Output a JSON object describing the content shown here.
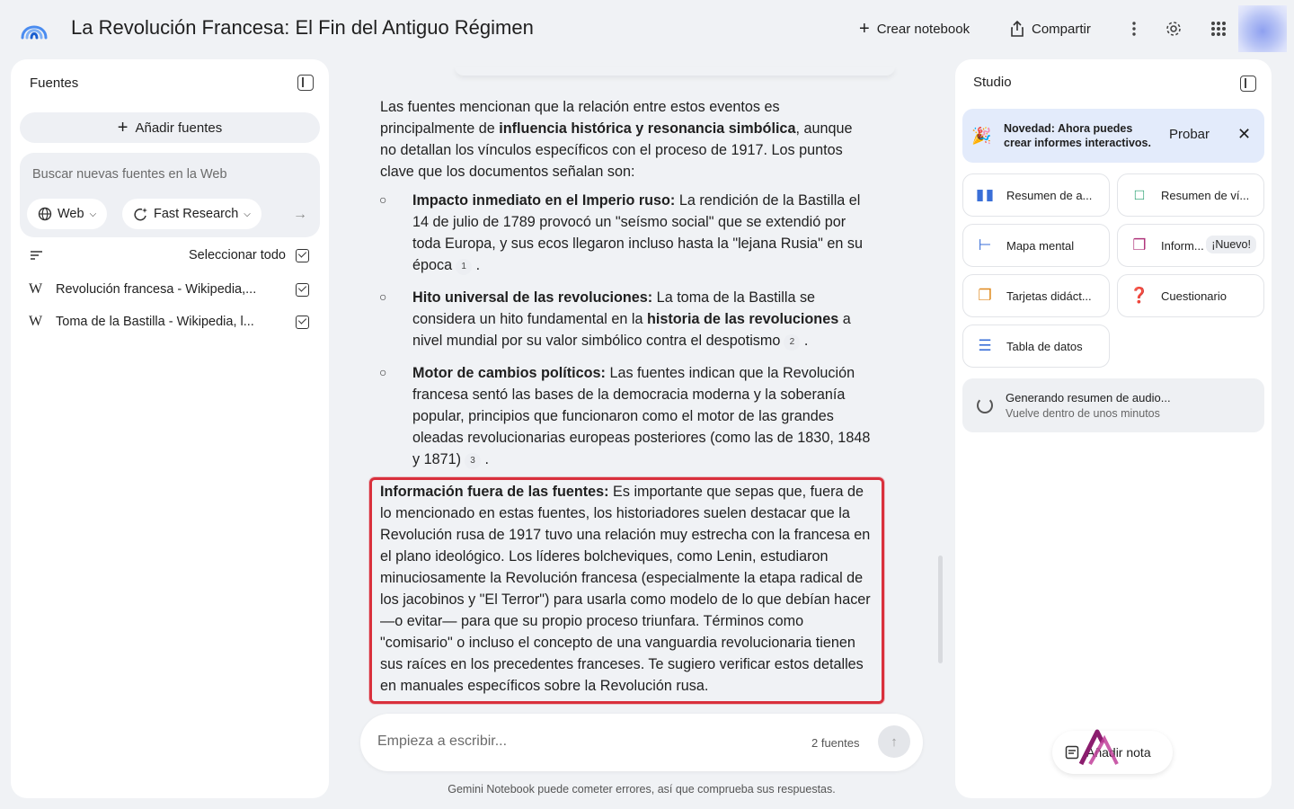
{
  "header": {
    "title": "La Revolución Francesa: El Fin del Antiguo Régimen",
    "create_label": "Crear notebook",
    "share_label": "Compartir"
  },
  "colors": {
    "highlight": "#d9303c",
    "banner": "#e3ebfb",
    "accent": "#1a73e8"
  },
  "sources": {
    "title": "Fuentes",
    "add_label": "Añadir fuentes",
    "search_placeholder": "Buscar nuevas fuentes en la Web",
    "chip_web": "Web",
    "chip_research": "Fast Research",
    "select_all": "Seleccionar todo",
    "items": [
      {
        "label": "Revolución francesa - Wikipedia,...",
        "icon": "W"
      },
      {
        "label": "Toma de la Bastilla - Wikipedia, l...",
        "icon": "W"
      }
    ]
  },
  "chat": {
    "intro_plain_1": "Las fuentes mencionan que la relación entre estos eventos es principalmente de ",
    "intro_bold": "influencia histórica y resonancia simbólica",
    "intro_plain_2": ", aunque no detallan los vínculos específicos con el proceso de 1917. Los puntos clave que los documentos señalan son:",
    "bullets": [
      {
        "bold": "Impacto inmediato en el Imperio ruso:",
        "text": " La rendición de la Bastilla el 14 de julio de 1789 provocó un \"seísmo social\" que se extendió por toda Europa, y sus ecos llegaron incluso hasta la \"lejana Rusia\" en su época",
        "cite": "1"
      },
      {
        "bold": "Hito universal de las revoluciones:",
        "text": " La toma de la Bastilla se considera un hito fundamental en la ",
        "bold2": "historia de las revoluciones",
        "text2": " a nivel mundial por su valor simbólico contra el despotismo",
        "cite": "2"
      },
      {
        "bold": "Motor de cambios políticos:",
        "text": " Las fuentes indican que la Revolución francesa sentó las bases de la democracia moderna y la soberanía popular, principios que funcionaron como el motor de las grandes oleadas revolucionarias europeas posteriores (como las de 1830, 1848 y 1871)",
        "cite": "3"
      }
    ],
    "outside_bold": "Información fuera de las fuentes:",
    "outside_text": " Es importante que sepas que, fuera de lo mencionado en estas fuentes, los historiadores suelen destacar que la Revolución rusa de 1917 tuvo una relación muy estrecha con la francesa en el plano ideológico. Los líderes bolcheviques, como Lenin, estudiaron minuciosamente la Revolución francesa (especialmente la etapa radical de los jacobinos y \"El Terror\") para usarla como modelo de lo que debían hacer —o evitar— para que su propio proceso triunfara. Términos como \"comisario\" o incluso el concepto de una vanguardia revolucionaria tienen sus raíces en los precedentes franceses. Te sugiero verificar estos detalles en manuales específicos sobre la Revolución rusa.",
    "input_placeholder": "Empieza a escribir...",
    "source_count": "2 fuentes",
    "footer": "Gemini Notebook puede cometer errores, así que comprueba sus respuestas."
  },
  "studio": {
    "title": "Studio",
    "banner_text": "Novedad: Ahora puedes crear informes interactivos.",
    "banner_try": "Probar",
    "tiles": [
      {
        "label": "Resumen de a...",
        "icon": "audio-icon"
      },
      {
        "label": "Resumen de ví...",
        "icon": "video-icon"
      },
      {
        "label": "Mapa mental",
        "icon": "mindmap-icon"
      },
      {
        "label": "Inform...",
        "icon": "report-icon",
        "badge": "¡Nuevo!"
      },
      {
        "label": "Tarjetas didáct...",
        "icon": "flashcards-icon"
      },
      {
        "label": "Cuestionario",
        "icon": "quiz-icon"
      },
      {
        "label": "Tabla de datos",
        "icon": "table-icon"
      }
    ],
    "generating_title": "Generando resumen de audio...",
    "generating_sub": "Vuelve dentro de unos minutos",
    "add_note": "Añadir nota"
  }
}
